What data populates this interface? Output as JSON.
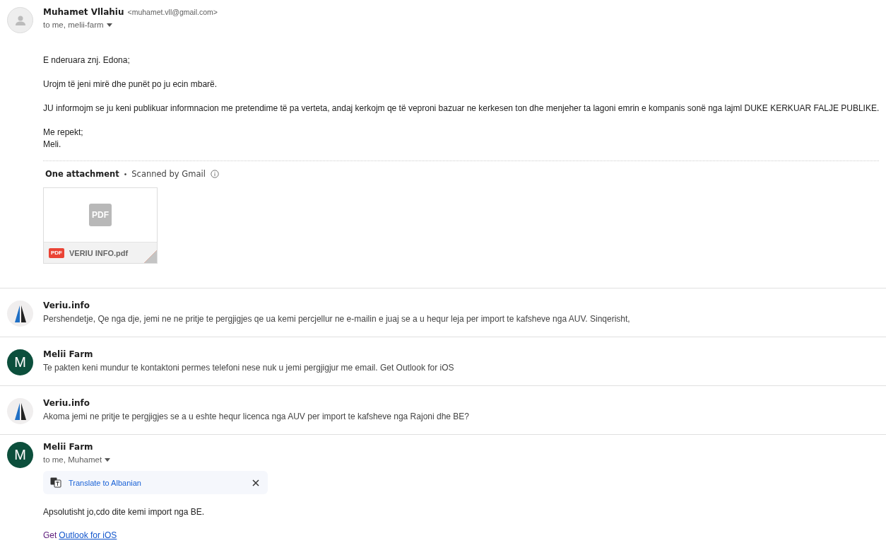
{
  "messages": [
    {
      "kind": "expanded",
      "avatar": {
        "kind": "person"
      },
      "sender": "Muhamet Vllahiu",
      "email": "<muhamet.vll@gmail.com>",
      "recipients": "to me, melii-farm",
      "paragraphs": [
        [
          "E nderuara znj. Edona;"
        ],
        [
          "Urojm të jeni mirë dhe punët po ju ecin mbarë."
        ],
        [
          "JU informojm se ju keni publikuar informnacion me pretendime të pa verteta, andaj  kerkojm qe të veproni bazuar ne kerkesen ton dhe menjeher ta lagoni emrin e kompanis sonë nga lajml DUKE KERKUAR FALJE PUBLIKE."
        ],
        [
          "Me repekt;",
          "Meli."
        ]
      ],
      "attachments": {
        "title": "One attachment",
        "separator": "•",
        "scan_note": "Scanned by Gmail",
        "files": [
          {
            "thumbnail": "PDF",
            "type_badge": "PDF",
            "name": "VERIU INFO.pdf"
          }
        ]
      }
    },
    {
      "kind": "collapsed",
      "avatar": {
        "kind": "logo"
      },
      "sender": "Veriu.info",
      "snippet": "Pershendetje, Qe nga dje, jemi ne ne pritje te pergjigjes qe ua kemi percjellur ne e-mailin e juaj se a u hequr leja per import te kafsheve nga AUV. Sinqerisht,"
    },
    {
      "kind": "collapsed",
      "avatar": {
        "kind": "letter",
        "letter": "M"
      },
      "sender": "Melii Farm",
      "snippet": "Te pakten keni mundur te kontaktoni permes telefoni nese nuk u jemi pergjigjur me email. Get Outlook for iOS"
    },
    {
      "kind": "collapsed",
      "avatar": {
        "kind": "logo"
      },
      "sender": "Veriu.info",
      "snippet": "Akoma jemi ne pritje te pergjigjes se a u eshte hequr licenca nga AUV per import te kafsheve nga Rajoni dhe BE?"
    },
    {
      "kind": "expanded",
      "avatar": {
        "kind": "letter",
        "letter": "M"
      },
      "sender": "Melii Farm",
      "recipients": "to me, Muhamet",
      "translate": {
        "label": "Translate to Albanian"
      },
      "paragraphs": [
        [
          "Apsolutisht jo,cdo dite kemi import nga BE."
        ]
      ],
      "footer": {
        "prefix": "Get",
        "link": "Outlook for iOS"
      }
    }
  ]
}
